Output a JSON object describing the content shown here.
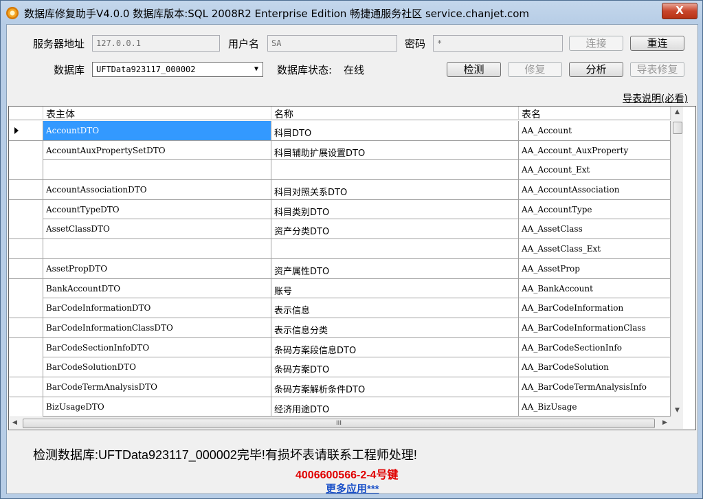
{
  "window": {
    "title": "数据库修复助手V4.0.0 数据库版本:SQL 2008R2 Enterprise Edition  畅捷通服务社区 service.chanjet.com",
    "close_label": "X"
  },
  "form": {
    "server_label": "服务器地址",
    "server_value": "127.0.0.1",
    "user_label": "用户名",
    "user_value": "SA",
    "password_label": "密码",
    "password_value": "*",
    "connect_label": "连接",
    "reconnect_label": "重连",
    "database_label": "数据库",
    "database_value": "UFTData923117_000002",
    "db_status_label": "数据库状态:",
    "db_status_value": "在线",
    "detect_label": "检测",
    "repair_label": "修复",
    "analyze_label": "分析",
    "import_repair_label": "导表修复",
    "import_help_link": "导表说明(必看)"
  },
  "grid": {
    "headers": [
      "",
      "表主体",
      "名称",
      "表名"
    ],
    "rows": [
      {
        "entity": "AccountDTO",
        "name": "科目DTO",
        "table": "AA_Account"
      },
      {
        "entity": "AccountAuxPropertySetDTO",
        "name": "科目辅助扩展设置DTO",
        "table": "AA_Account_AuxProperty"
      },
      {
        "entity": "",
        "name": "",
        "table": "AA_Account_Ext"
      },
      {
        "entity": "AccountAssociationDTO",
        "name": "科目对照关系DTO",
        "table": "AA_AccountAssociation"
      },
      {
        "entity": "AccountTypeDTO",
        "name": "科目类别DTO",
        "table": "AA_AccountType"
      },
      {
        "entity": "AssetClassDTO",
        "name": "资产分类DTO",
        "table": "AA_AssetClass"
      },
      {
        "entity": "",
        "name": "",
        "table": "AA_AssetClass_Ext"
      },
      {
        "entity": "AssetPropDTO",
        "name": "资产属性DTO",
        "table": "AA_AssetProp"
      },
      {
        "entity": "BankAccountDTO",
        "name": "账号",
        "table": "AA_BankAccount"
      },
      {
        "entity": "BarCodeInformationDTO",
        "name": "表示信息",
        "table": "AA_BarCodeInformation"
      },
      {
        "entity": "BarCodeInformationClassDTO",
        "name": "表示信息分类",
        "table": "AA_BarCodeInformationClass"
      },
      {
        "entity": "BarCodeSectionInfoDTO",
        "name": "条码方案段信息DTO",
        "table": "AA_BarCodeSectionInfo"
      },
      {
        "entity": "BarCodeSolutionDTO",
        "name": "条码方案DTO",
        "table": "AA_BarCodeSolution"
      },
      {
        "entity": "BarCodeTermAnalysisDTO",
        "name": "条码方案解析条件DTO",
        "table": "AA_BarCodeTermAnalysisInfo"
      },
      {
        "entity": "BizUsageDTO",
        "name": "经济用途DTO",
        "table": "AA_BizUsage"
      }
    ],
    "hscroll_grip": "III"
  },
  "footer": {
    "status_message": "检测数据库:UFTData923117_000002完毕!有损坏表请联系工程师处理!",
    "hotline": "4006600566-2-4号键",
    "more_apps_link": "更多应用***"
  },
  "colors": {
    "selected_row": "#3399ff",
    "hotline": "#e00000",
    "link": "#1a50c8"
  }
}
